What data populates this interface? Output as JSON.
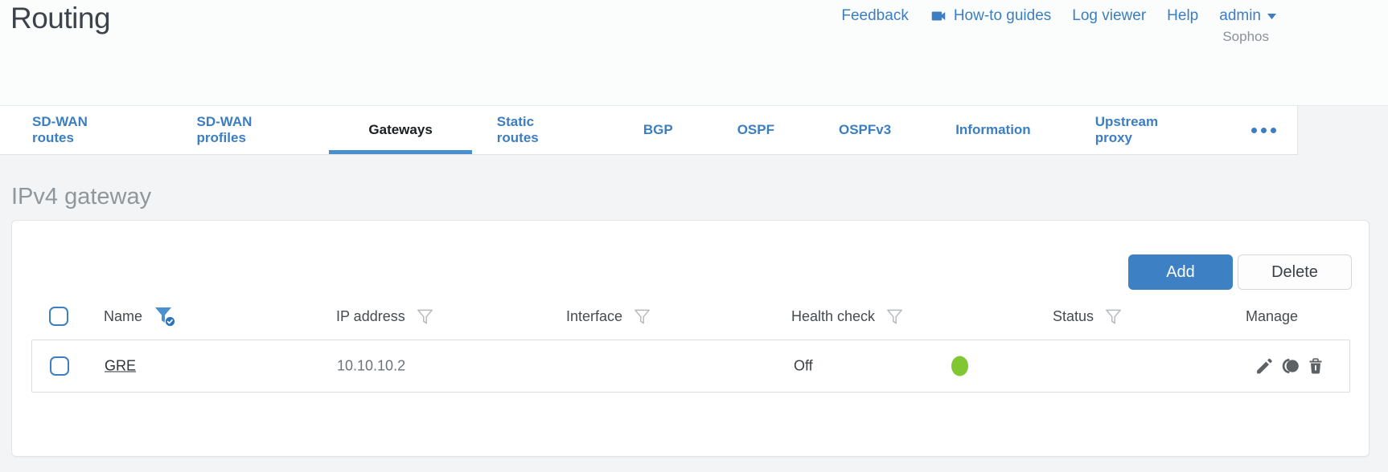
{
  "page": {
    "title": "Routing",
    "brand": "Sophos"
  },
  "header_links": {
    "feedback": "Feedback",
    "howto": "How-to guides",
    "log_viewer": "Log viewer",
    "help": "Help",
    "user": "admin"
  },
  "tabs": {
    "items": [
      {
        "label": "SD-WAN routes",
        "active": false
      },
      {
        "label": "SD-WAN profiles",
        "active": false
      },
      {
        "label": "Gateways",
        "active": true
      },
      {
        "label": "Static routes",
        "active": false
      },
      {
        "label": "BGP",
        "active": false
      },
      {
        "label": "OSPF",
        "active": false
      },
      {
        "label": "OSPFv3",
        "active": false
      },
      {
        "label": "Information",
        "active": false
      },
      {
        "label": "Upstream proxy",
        "active": false
      }
    ],
    "more": "ellipsis-icon"
  },
  "section": {
    "heading": "IPv4 gateway"
  },
  "toolbar": {
    "add_label": "Add",
    "delete_label": "Delete"
  },
  "table": {
    "columns": [
      "Name",
      "IP address",
      "Interface",
      "Health check",
      "Status",
      "Manage"
    ],
    "name_filter_state": "active",
    "other_filter_state": "inactive",
    "rows": [
      {
        "name": "GRE",
        "ip_address": "10.10.10.2",
        "interface": "",
        "health_check": "Off",
        "status": "green",
        "manage": [
          "pencil-icon",
          "clone-icon",
          "trash-icon"
        ]
      }
    ]
  },
  "icons": {
    "howto": "videocam-icon",
    "user_menu": "caret-down-icon",
    "name_filter": "funnel-check-icon",
    "column_filter": "funnel-icon",
    "status": "green-dot"
  },
  "colors": {
    "accent_blue": "#3b7ec1",
    "tab_underline": "#4a8fcd",
    "add_button_blue": "#3d80c3",
    "status_green": "#80c732",
    "title_gray": "#3c434a",
    "section_heading_gray": "#8f969c"
  }
}
